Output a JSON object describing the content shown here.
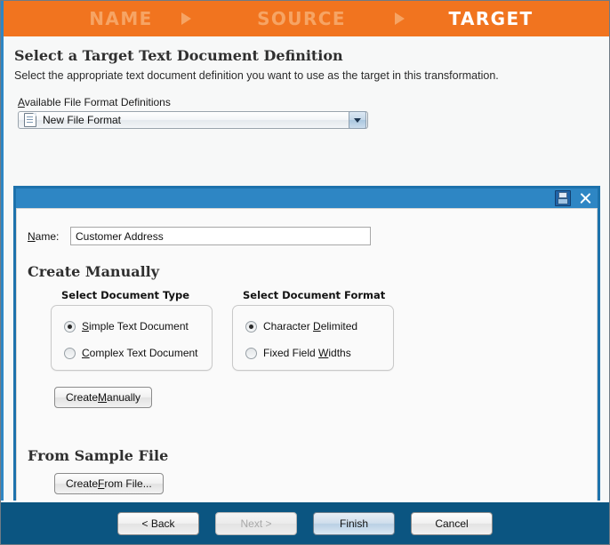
{
  "wizard": {
    "steps": [
      {
        "label": "NAME",
        "state": "inactive"
      },
      {
        "label": "SOURCE",
        "state": "inactive"
      },
      {
        "label": "TARGET",
        "state": "active"
      }
    ],
    "accent_orange": "#f1741f",
    "accent_orange_dim": "#f6a464",
    "accent_blue": "#2e86c4",
    "footer_blue": "#0b5581"
  },
  "page": {
    "title": "Select a Target Text Document Definition",
    "subtitle": "Select the appropriate text document definition you want to use as the target in this transformation.",
    "definitions_label": "Available File Format Definitions",
    "definitions_selected": "New File Format",
    "definitions_icon": "document-icon",
    "dropdown_icon": "chevron-down-icon"
  },
  "panel": {
    "save_icon": "save-icon",
    "close_icon": "close-icon",
    "name_label": "Name:",
    "name_value": "Customer Address",
    "name_placeholder": "",
    "create_manually_heading": "Create Manually",
    "document_type": {
      "title": "Select Document Type",
      "options": [
        {
          "label": "Simple Text Document",
          "checked": true
        },
        {
          "label": "Complex Text Document",
          "checked": false
        }
      ]
    },
    "document_format": {
      "title": "Select Document Format",
      "options": [
        {
          "label": "Character Delimited",
          "checked": true
        },
        {
          "label": "Fixed Field Widths",
          "checked": false
        }
      ]
    },
    "create_manually_button": "Create Manually",
    "from_sample_file_heading": "From Sample File",
    "create_from_file_button": "Create From File..."
  },
  "footer": {
    "back": {
      "label": "< Back",
      "state": "enabled"
    },
    "next": {
      "label": "Next >",
      "state": "disabled"
    },
    "finish": {
      "label": "Finish",
      "state": "default"
    },
    "cancel": {
      "label": "Cancel",
      "state": "enabled"
    }
  }
}
